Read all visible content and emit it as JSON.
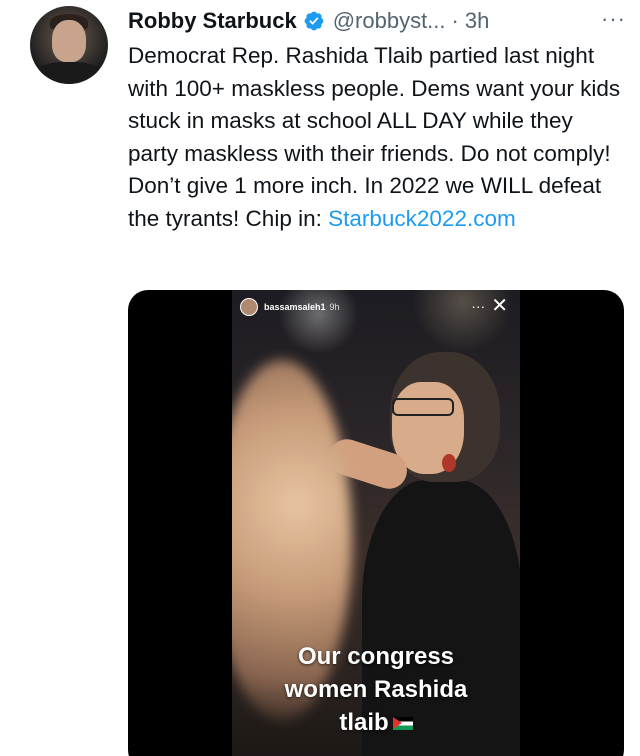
{
  "tweet": {
    "author_name": "Robby Starbuck",
    "handle": "@robbyst...",
    "separator": "·",
    "time": "3h",
    "more_label": "···",
    "text_main": "Democrat Rep. Rashida Tlaib partied last night with 100+ maskless people. Dems want your kids stuck in masks at school ALL DAY while they party maskless with their friends. Do not comply! Don’t give 1 more inch. In 2022 we WILL defeat the tyrants! Chip in: ",
    "link_text": "Starbuck2022.com",
    "verified_icon": "verified-badge-icon",
    "colors": {
      "text": "#0f1419",
      "secondary": "#536471",
      "link": "#1d9bf0",
      "verified": "#1d9bf0"
    }
  },
  "media": {
    "story_user": "bassamsaleh1",
    "story_time": "9h",
    "story_more": "···",
    "story_close": "✕",
    "caption_lines": [
      "Our congress",
      "women Rashida",
      "tlaib"
    ],
    "caption_icon": "palestine-flag-icon"
  }
}
